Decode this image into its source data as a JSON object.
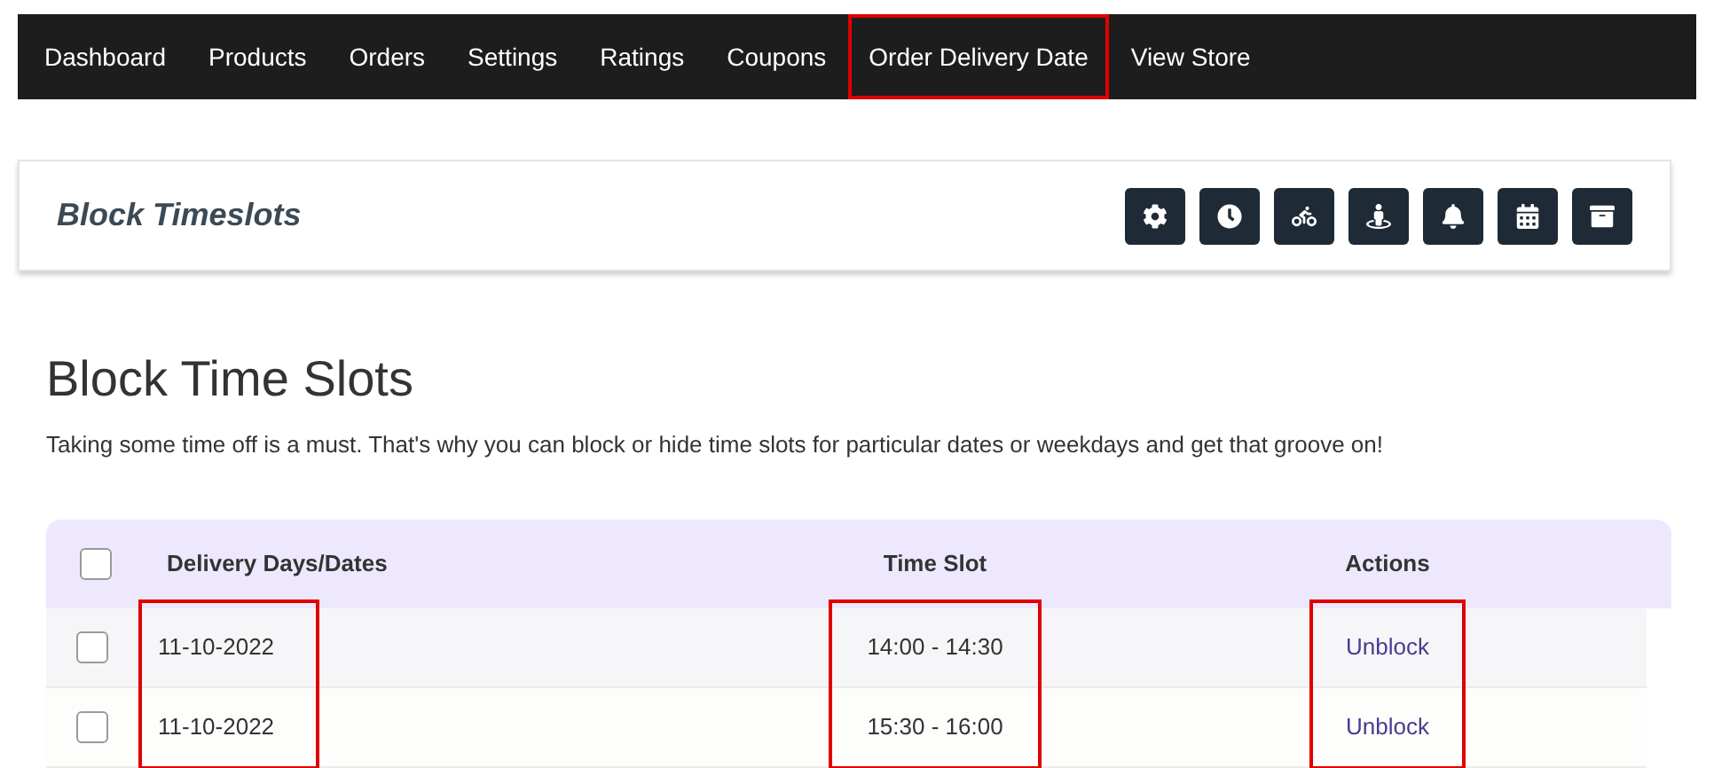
{
  "nav": [
    {
      "label": "Dashboard",
      "highlighted": false
    },
    {
      "label": "Products",
      "highlighted": false
    },
    {
      "label": "Orders",
      "highlighted": false
    },
    {
      "label": "Settings",
      "highlighted": false
    },
    {
      "label": "Ratings",
      "highlighted": false
    },
    {
      "label": "Coupons",
      "highlighted": false
    },
    {
      "label": "Order Delivery Date",
      "highlighted": true
    },
    {
      "label": "View Store",
      "highlighted": false
    }
  ],
  "header": {
    "title": "Block Timeslots",
    "toolbar": [
      {
        "kind": "settings"
      },
      {
        "kind": "clock"
      },
      {
        "kind": "bicycle"
      },
      {
        "kind": "person"
      },
      {
        "kind": "bell"
      },
      {
        "kind": "calendar"
      },
      {
        "kind": "archive"
      }
    ]
  },
  "heading": "Block Time Slots",
  "description": "Taking some time off is a must. That's why you can block or hide time slots for particular dates or weekdays and get that groove on!",
  "table": {
    "select_all": {
      "checked": false
    },
    "columns": [
      {
        "label": "Delivery Days/Dates",
        "highlighted": true
      },
      {
        "label": "Time Slot",
        "highlighted": true
      },
      {
        "label": "Actions",
        "highlighted": true
      }
    ],
    "rows": [
      {
        "checked": false,
        "date": "11-10-2022",
        "time_slot": "14:00 - 14:30",
        "action": "Unblock"
      },
      {
        "checked": false,
        "date": "11-10-2022",
        "time_slot": "15:30 - 16:00",
        "action": "Unblock"
      }
    ]
  }
}
